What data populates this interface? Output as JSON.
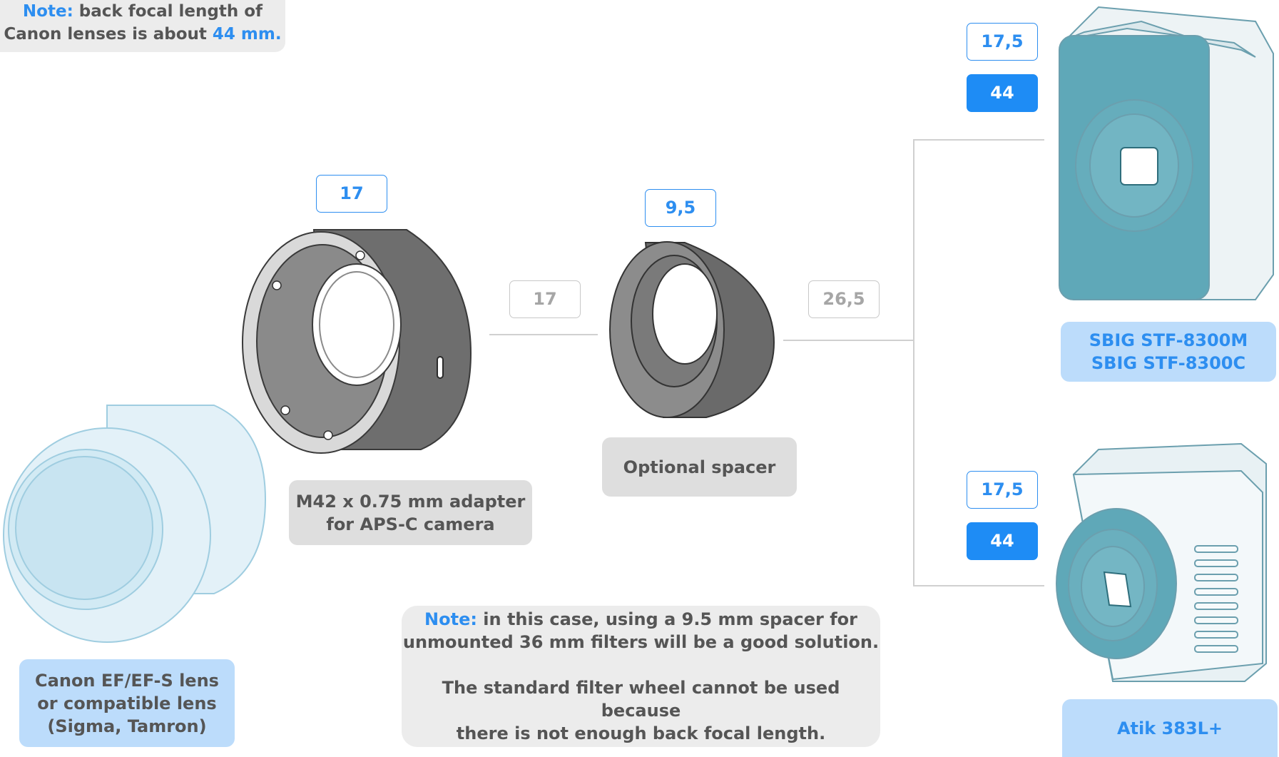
{
  "top_note": {
    "prefix": "Note:",
    "line1_rest": " back focal length of",
    "line2_start": "Canon lenses is about ",
    "value": "44 mm."
  },
  "adapter": {
    "distance": "17",
    "label_line1": "M42 x 0.75 mm adapter",
    "label_line2": "for APS-C camera"
  },
  "link_adapter_spacer": "17",
  "spacer": {
    "distance": "9,5",
    "label": "Optional spacer"
  },
  "link_spacer_camera": "26,5",
  "lens": {
    "label_line1": "Canon EF/EF-S lens",
    "label_line2": "or compatible lens",
    "label_line3": "(Sigma, Tamron)"
  },
  "camera_sbig": {
    "distance": "17,5",
    "total": "44",
    "label_line1": "SBIG STF-8300M",
    "label_line2": "SBIG STF-8300C"
  },
  "camera_atik": {
    "distance": "17,5",
    "total": "44",
    "label": "Atik 383L+"
  },
  "bottom_note": {
    "prefix": "Note:",
    "line1_rest": " in this case, using a 9.5 mm spacer for",
    "line2": "unmounted 36 mm filters will be a good solution.",
    "line3": "The standard filter wheel cannot be used because",
    "line4": "there is not enough back focal length."
  },
  "colors": {
    "accent": "#1e8cf5",
    "label_blue_bg": "#bcdcfb",
    "label_grey_bg": "#dedede",
    "note_bg": "#ececec",
    "camera_teal": "#5fa8b8",
    "part_grey": "#7d7d7d"
  }
}
